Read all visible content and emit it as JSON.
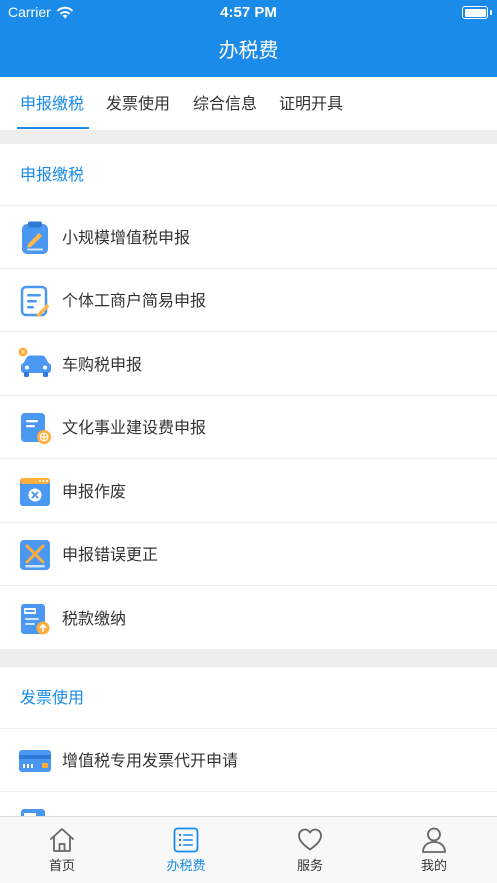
{
  "status_bar": {
    "carrier": "Carrier",
    "time": "4:57 PM"
  },
  "header": {
    "title": "办税费"
  },
  "tabs": [
    {
      "label": "申报缴税",
      "active": true
    },
    {
      "label": "发票使用",
      "active": false
    },
    {
      "label": "综合信息",
      "active": false
    },
    {
      "label": "证明开具",
      "active": false
    }
  ],
  "sections": [
    {
      "title": "申报缴税",
      "items": [
        {
          "label": "小规模增值税申报",
          "icon": "clipboard-pen-icon"
        },
        {
          "label": "个体工商户简易申报",
          "icon": "form-pen-icon"
        },
        {
          "label": "车购税申报",
          "icon": "car-icon"
        },
        {
          "label": "文化事业建设费申报",
          "icon": "document-globe-icon"
        },
        {
          "label": "申报作废",
          "icon": "window-cancel-icon"
        },
        {
          "label": "申报错误更正",
          "icon": "correction-icon"
        },
        {
          "label": "税款缴纳",
          "icon": "tax-payment-icon"
        }
      ]
    },
    {
      "title": "发票使用",
      "items": [
        {
          "label": "增值税专用发票代开申请",
          "icon": "invoice-card-icon"
        }
      ]
    }
  ],
  "tabbar": [
    {
      "label": "首页",
      "icon": "home-icon",
      "active": false
    },
    {
      "label": "办税费",
      "icon": "list-icon",
      "active": true
    },
    {
      "label": "服务",
      "icon": "heart-icon",
      "active": false
    },
    {
      "label": "我的",
      "icon": "user-icon",
      "active": false
    }
  ],
  "colors": {
    "primary": "#1a8be8",
    "background_gap": "#eeeeee",
    "text": "#333333"
  }
}
